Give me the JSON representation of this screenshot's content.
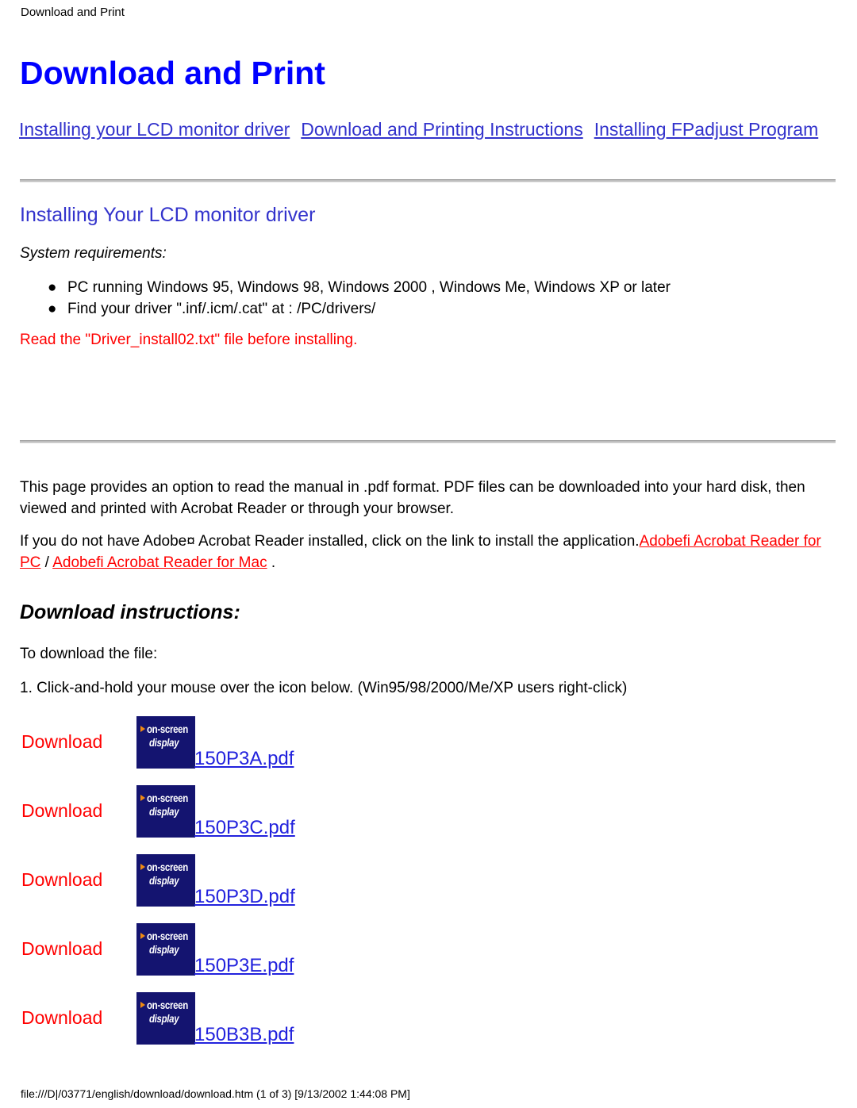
{
  "page_header": "Download and Print",
  "title": "Download and Print",
  "nav": {
    "links": [
      {
        "label": "Installing your LCD monitor driver"
      },
      {
        "label": "Download and Printing Instructions"
      },
      {
        "label": "Installing FPadjust Program"
      }
    ]
  },
  "driver_section": {
    "heading": "Installing Your LCD monitor driver",
    "sysreq_label": "System requirements:",
    "requirements": [
      "PC running Windows 95, Windows 98, Windows 2000 , Windows Me, Windows XP or later",
      "Find your driver \".inf/.icm/.cat\" at : /PC/drivers/"
    ],
    "bullet_glyph": "●",
    "warning": "Read the \"Driver_install02.txt\" file before installing."
  },
  "pdf_section": {
    "paragraph_1": "This page provides an option to read the manual in .pdf format. PDF files can be downloaded into your hard disk, then viewed and printed with Acrobat Reader or through your browser.",
    "paragraph_2_part_1": "If you do not have Adobe¤ Acrobat Reader installed, click on the link to install the application.",
    "link_pc": "Adobefi Acrobat Reader for PC",
    "separator": " / ",
    "link_mac": "Adobefi Acrobat Reader for Mac",
    "paragraph_2_end": " ."
  },
  "download_section": {
    "heading": "Download instructions:",
    "line_1": "To download the file:",
    "line_2": "1. Click-and-hold your mouse over the icon below. (Win95/98/2000/Me/XP users right-click)",
    "icon": {
      "line_1": "on-screen",
      "line_2": "display",
      "bg_color": "#141470",
      "arrow_color": "#ef8a12",
      "text_color": "#ffffff"
    },
    "rows": [
      {
        "label": "Download",
        "file": "150P3A.pdf"
      },
      {
        "label": "Download",
        "file": "150P3C.pdf"
      },
      {
        "label": "Download",
        "file": "150P3D.pdf"
      },
      {
        "label": "Download",
        "file": "150P3E.pdf"
      },
      {
        "label": "Download",
        "file": "150B3B.pdf"
      }
    ]
  },
  "footer": "file:///D|/03771/english/download/download.htm (1 of 3) [9/13/2002 1:44:08 PM]",
  "colors": {
    "heading_blue": "#0000ff",
    "link_blue": "#3333cc",
    "link_red": "#ff0000",
    "pdf_link_blue": "#2222dd"
  }
}
